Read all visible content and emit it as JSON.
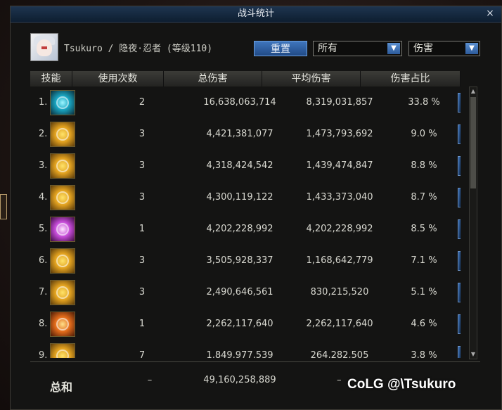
{
  "window": {
    "title": "战斗统计",
    "close": "×"
  },
  "character": {
    "label": "Tsukuro / 隐夜·忍者 (等级110)"
  },
  "controls": {
    "reset_label": "重置",
    "filter_value": "所有",
    "metric_value": "伤害",
    "dropdown_arrow": "▼"
  },
  "table": {
    "headers": [
      "技能",
      "使用次数",
      "总伤害",
      "平均伤害",
      "伤害占比"
    ],
    "rows": [
      {
        "index": "1.",
        "uses": "2",
        "total": "16,638,063,714",
        "avg": "8,319,031,857",
        "pct": "33.8 %"
      },
      {
        "index": "2.",
        "uses": "3",
        "total": "4,421,381,077",
        "avg": "1,473,793,692",
        "pct": "9.0 %"
      },
      {
        "index": "3.",
        "uses": "3",
        "total": "4,318,424,542",
        "avg": "1,439,474,847",
        "pct": "8.8 %"
      },
      {
        "index": "4.",
        "uses": "3",
        "total": "4,300,119,122",
        "avg": "1,433,373,040",
        "pct": "8.7 %"
      },
      {
        "index": "5.",
        "uses": "1",
        "total": "4,202,228,992",
        "avg": "4,202,228,992",
        "pct": "8.5 %"
      },
      {
        "index": "6.",
        "uses": "3",
        "total": "3,505,928,337",
        "avg": "1,168,642,779",
        "pct": "7.1 %"
      },
      {
        "index": "7.",
        "uses": "3",
        "total": "2,490,646,561",
        "avg": "830,215,520",
        "pct": "5.1 %"
      },
      {
        "index": "8.",
        "uses": "1",
        "total": "2,262,117,640",
        "avg": "2,262,117,640",
        "pct": "4.6 %"
      },
      {
        "index": "9.",
        "uses": "7",
        "total": "1,849,977,539",
        "avg": "264,282,505",
        "pct": "3.8 %"
      }
    ]
  },
  "summary": {
    "label": "总和",
    "uses": "–",
    "total": "49,160,258,889",
    "avg": "–"
  },
  "watermark": "CoLG @\\Tsukuro"
}
